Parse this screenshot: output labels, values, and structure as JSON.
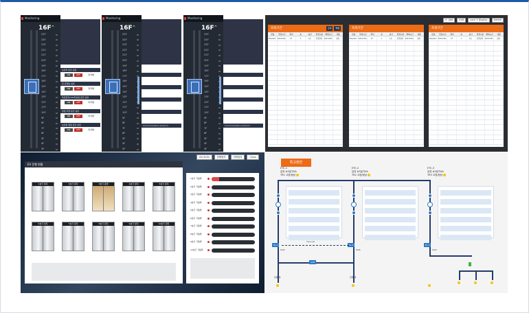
{
  "elevator": {
    "panels": [
      {
        "title": "Monitoring",
        "floor": "16F",
        "arrow": "⌃",
        "floors": [
          "25F",
          "24F",
          "23F",
          "22F",
          "21F",
          "20F",
          "19F",
          "18F",
          "17F",
          "16F",
          "15F",
          "14F",
          "13F",
          "12F",
          "11F",
          "10F",
          "9F",
          "8F",
          "7F",
          "6F",
          "5F",
          "4F",
          "3F",
          "2F",
          "1F",
          "B1",
          "B2",
          "B3"
        ],
        "controls": [
          {
            "label": "보안화 운전 설정",
            "on": "ON",
            "off": "OFF",
            "aux1": "개/개방",
            "aux2": "고장 알림"
          },
          {
            "label": "탑 운행중 설정",
            "on": "ON",
            "off": "OFF",
            "aux1": "개/개방"
          },
          {
            "label": "독립운전/VIP/최상층 운전 설정",
            "on": "ON",
            "off": "OFF",
            "aux1": "개/개방"
          },
          {
            "label": "방범 주행 운전 설정",
            "on": "ON",
            "off": "OFF",
            "aux1": "개/개방"
          },
          {
            "label": "보안층 열림 운전 설정",
            "on": "ON",
            "off": "OFF",
            "aux1": "개/개방"
          }
        ]
      },
      {
        "title": "Monitoring",
        "floor": "16F",
        "arrow": "⌃",
        "comm": "Communication protocol"
      },
      {
        "title": "Monitoring",
        "floor": "16F",
        "arrow": "⌃",
        "comm": "Communication protocol"
      }
    ]
  },
  "tables": {
    "top_buttons": [
      "I+ Add",
      "Edit",
      "Lock 3 Display",
      "Delete"
    ],
    "cards": [
      {
        "title": "조회기간",
        "tools": [
          "조회",
          "엑셀"
        ],
        "headers": [
          "번호",
          "발생시간",
          "위치",
          "층",
          "호기",
          "발생구분",
          "해제시간",
          "내용"
        ],
        "first_row": [
          "Elevator",
          "2016-08-23",
          "1F",
          "1",
          "1호",
          "운행정지",
          "2016-08-23",
          "정지"
        ]
      },
      {
        "title": "조회기간",
        "tools": [],
        "headers": [
          "번호",
          "발생시간",
          "위치",
          "층",
          "호기",
          "발생구분",
          "해제시간",
          "내용"
        ],
        "first_row": [
          "Elevator",
          "2016-08-23",
          "1F",
          "1",
          "1호",
          "운행정지",
          "2016-08-23",
          "정지"
        ]
      },
      {
        "title": "조회기간",
        "tools": [],
        "headers": [
          "번호",
          "발생시간",
          "위치",
          "층",
          "호기",
          "발생구분",
          "해제시간",
          "내용"
        ],
        "first_row": [
          "Elevator",
          "2016-08-23",
          "1F",
          "1",
          "1호",
          "운행정지",
          "2016-08-23",
          "정지"
        ]
      }
    ]
  },
  "doors": {
    "tools": [
      "ON SIGN",
      "운행정지",
      "전체정지",
      "Close"
    ],
    "title": "EV 운행 현황",
    "cars": [
      {
        "label": "1호기 정지",
        "open": false
      },
      {
        "label": "2호기 정지",
        "open": false
      },
      {
        "label": "3호기 운행",
        "open": true
      },
      {
        "label": "4호기 정지",
        "open": false
      },
      {
        "label": "5호기 정지",
        "open": false
      },
      {
        "label": "6호기 정지",
        "open": false
      },
      {
        "label": "7호기 정지",
        "open": false
      },
      {
        "label": "8호기 정지",
        "open": false
      },
      {
        "label": "9호기 정지",
        "open": false
      },
      {
        "label": "10호기 정지",
        "open": false
      }
    ],
    "status_rows": [
      {
        "label": "1호기 가동율",
        "level": 0.18
      },
      {
        "label": "2호기 가동율",
        "level": 0
      },
      {
        "label": "3호기 가동율",
        "level": 0
      },
      {
        "label": "4호기 가동율",
        "level": 0
      },
      {
        "label": "5호기 가동율",
        "level": 0
      },
      {
        "label": "6호기 가동율",
        "level": 0
      },
      {
        "label": "7호기 가동율",
        "level": 0
      },
      {
        "label": "8호기 가동율",
        "level": 0
      },
      {
        "label": "9호기 가동율",
        "level": 0
      },
      {
        "label": "10호기 가동율",
        "level": 0
      }
    ]
  },
  "wiring": {
    "title": "특고장반",
    "etc": [
      {
        "name": "ETC-1",
        "line1": "입전 #5분기VA",
        "line2": "TR1 고장/정상"
      },
      {
        "name": "ETC-2",
        "line1": "입전 #5분기VA",
        "line2": "TR2 고장/정상"
      },
      {
        "name": "ETC-3",
        "line1": "입전 #5분기VA",
        "line2": "TR3 고장/정상"
      }
    ],
    "tags": [
      "PL-1",
      "PL-2",
      "PL-3",
      "Tie Lock",
      "ACB"
    ],
    "labels": [
      "OCR",
      "OCR",
      "OCR",
      "전류 계",
      "전류 계"
    ]
  }
}
